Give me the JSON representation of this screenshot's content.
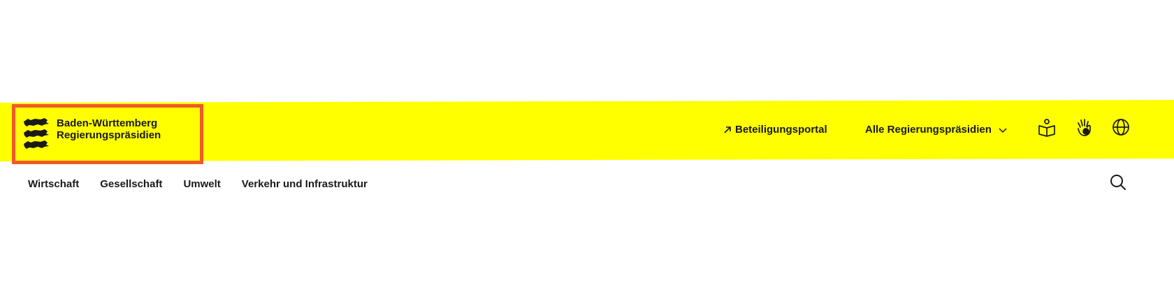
{
  "brand": {
    "line1": "Baden-Württemberg",
    "line2": "Regierungspräsidien",
    "icon": "three-lions-coat-of-arms",
    "highlight_color": "#f05a28"
  },
  "header": {
    "background": "#ffff00",
    "participation_link": {
      "label": "Beteiligungsportal",
      "icon": "arrow-up-right-icon"
    },
    "presidia_menu": {
      "label": "Alle Regierungspräsidien",
      "icon": "chevron-down-icon"
    },
    "utility_icons": [
      "easy-language-icon",
      "sign-language-icon",
      "globe-icon"
    ]
  },
  "nav": {
    "items": [
      {
        "label": "Wirtschaft"
      },
      {
        "label": "Gesellschaft"
      },
      {
        "label": "Umwelt"
      },
      {
        "label": "Verkehr und Infrastruktur"
      }
    ],
    "search_icon": "search-icon"
  }
}
